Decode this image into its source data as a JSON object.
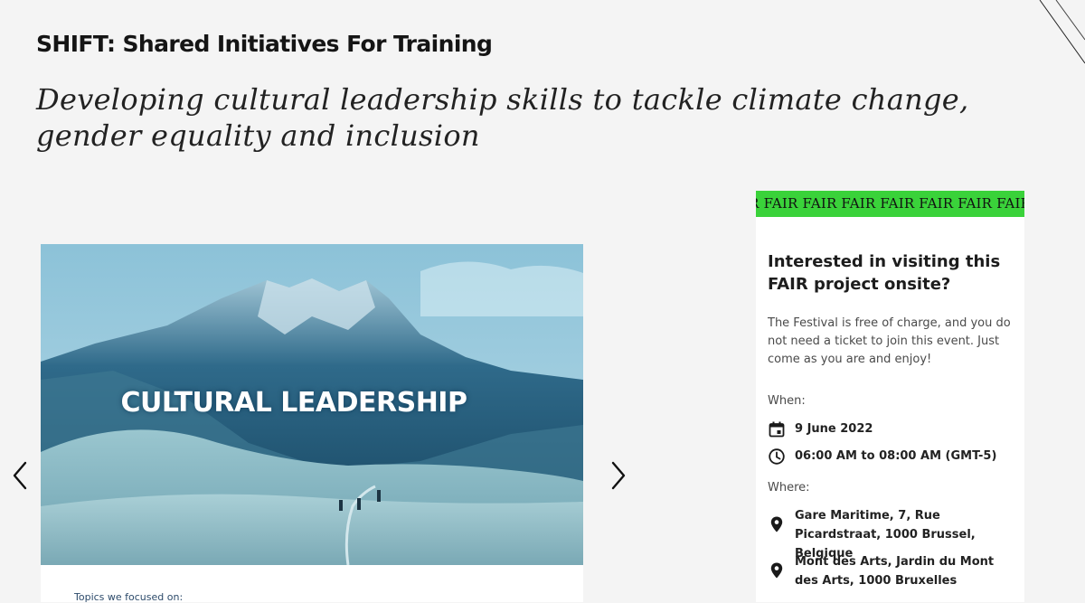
{
  "header": {
    "title": "SHIFT: Shared Initiatives For Training",
    "subtitle": "Developing cultural leadership skills to tackle climate change, gender equality and inclusion"
  },
  "carousel": {
    "slide_caption": "CULTURAL LEADERSHIP",
    "prev_icon": "chevron-left-icon",
    "next_icon": "chevron-right-icon",
    "below_text": "Topics we focused on:"
  },
  "sidebar": {
    "banner_text": "IR FAIR FAIR FAIR FAIR FAIR FAIR FAIR",
    "banner_color": "#3ad23a",
    "heading": "Interested in visiting this FAIR project onsite?",
    "description": "The Festival is free of charge, and you do not need a ticket to join this event. Just come as you are and enjoy!",
    "when_label": "When:",
    "date": "9 June 2022",
    "time": "06:00 AM to 08:00 AM (GMT-5)",
    "where_label": "Where:",
    "locations": [
      "Gare Maritime, 7, Rue Picardstraat, 1000 Brussel, Belgique",
      "Mont des Arts, Jardin du Mont des Arts, 1000 Bruxelles"
    ]
  }
}
